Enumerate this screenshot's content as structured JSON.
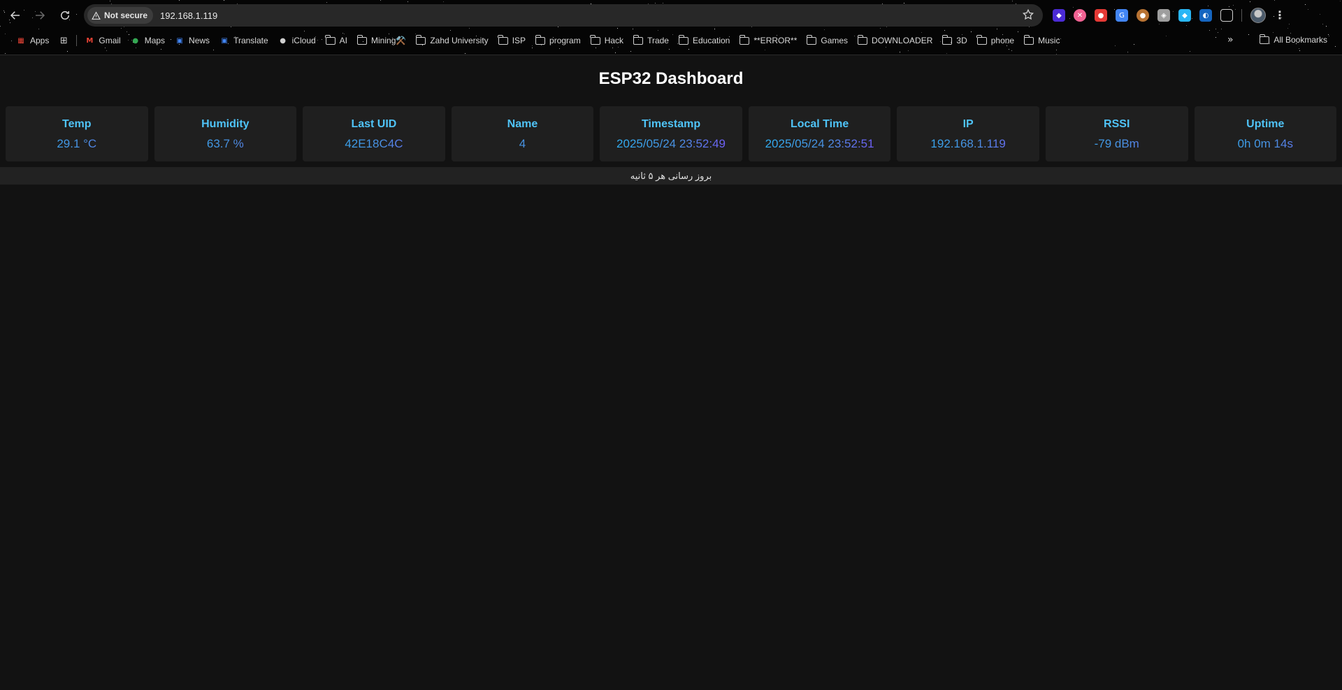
{
  "browser": {
    "security_label": "Not secure",
    "url": "192.168.1.119",
    "bookmarks": [
      {
        "label": "Apps",
        "icon": "apps-grid-icon"
      },
      {
        "label": "Gmail",
        "icon": "gmail-icon"
      },
      {
        "label": "Maps",
        "icon": "maps-icon"
      },
      {
        "label": "News",
        "icon": "news-icon"
      },
      {
        "label": "Translate",
        "icon": "translate-icon"
      },
      {
        "label": "iCloud",
        "icon": "apple-icon"
      },
      {
        "label": "AI",
        "icon": "folder-icon"
      },
      {
        "label": "Mining⚒️",
        "icon": "folder-icon"
      },
      {
        "label": "Zahd University",
        "icon": "folder-icon"
      },
      {
        "label": "ISP",
        "icon": "folder-icon"
      },
      {
        "label": "program",
        "icon": "folder-icon"
      },
      {
        "label": "Hack",
        "icon": "folder-icon"
      },
      {
        "label": "Trade",
        "icon": "folder-icon"
      },
      {
        "label": "Education",
        "icon": "folder-icon"
      },
      {
        "label": "**ERROR**",
        "icon": "folder-icon"
      },
      {
        "label": "Games",
        "icon": "folder-icon"
      },
      {
        "label": "DOWNLOADER",
        "icon": "folder-icon"
      },
      {
        "label": "3D",
        "icon": "folder-icon"
      },
      {
        "label": "phone",
        "icon": "folder-icon"
      },
      {
        "label": "Music",
        "icon": "folder-icon"
      }
    ],
    "more_label": "»",
    "all_bookmarks_label": "All Bookmarks"
  },
  "dashboard": {
    "title": "ESP32 Dashboard",
    "cards": [
      {
        "label": "Temp",
        "value": "29.1 °C"
      },
      {
        "label": "Humidity",
        "value": "63.7 %"
      },
      {
        "label": "Last UID",
        "value": "42E18C4C"
      },
      {
        "label": "Name",
        "value": "4"
      },
      {
        "label": "Timestamp",
        "value": "2025/05/24 23:52:49"
      },
      {
        "label": "Local Time",
        "value": "2025/05/24 23:52:51"
      },
      {
        "label": "IP",
        "value": "192.168.1.119"
      },
      {
        "label": "RSSI",
        "value": "-79 dBm"
      },
      {
        "label": "Uptime",
        "value": "0h 0m 14s"
      }
    ],
    "footer": "بروز رسانی هر ۵ ثانیه"
  },
  "colors": {
    "page_bg": "#121212",
    "card_bg": "#1f1f1f",
    "label": "#4fc3f7",
    "value_gradient_start": "#29b6f6",
    "value_gradient_end": "#7c4dff"
  }
}
